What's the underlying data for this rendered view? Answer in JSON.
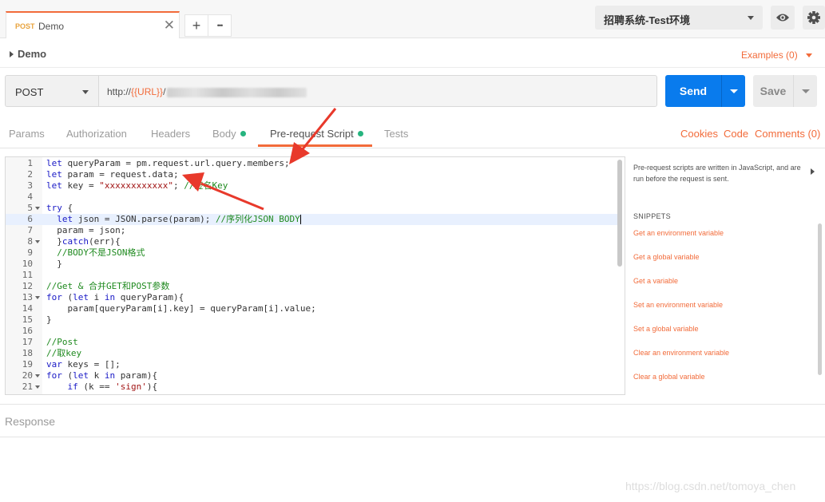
{
  "tab": {
    "method": "POST",
    "name": "Demo",
    "close": "✕",
    "new_tab": "+",
    "more": "•••"
  },
  "environment": {
    "selected": "招聘系统-Test环境"
  },
  "request": {
    "title": "Demo",
    "examples": "Examples (0)"
  },
  "url_bar": {
    "method": "POST",
    "url_prefix": "http://",
    "url_var": "{{URL}}",
    "url_suffix": "/"
  },
  "buttons": {
    "send": "Send",
    "save": "Save"
  },
  "subtabs": {
    "params": "Params",
    "authorization": "Authorization",
    "headers": "Headers",
    "body": "Body",
    "prerequest": "Pre-request Script",
    "tests": "Tests"
  },
  "links": {
    "cookies": "Cookies",
    "code": "Code",
    "comments": "Comments (0)"
  },
  "editor": {
    "cursor_line": 6,
    "lines": [
      {
        "n": "1",
        "fold": false,
        "parts": [
          [
            "kw",
            "let"
          ],
          [
            "t",
            " queryParam = pm.request.url.query.members;"
          ]
        ]
      },
      {
        "n": "2",
        "fold": false,
        "parts": [
          [
            "kw",
            "let"
          ],
          [
            "t",
            " param = request.data;"
          ]
        ]
      },
      {
        "n": "3",
        "fold": false,
        "parts": [
          [
            "kw",
            "let"
          ],
          [
            "t",
            " key = "
          ],
          [
            "str",
            "\"xxxxxxxxxxxx\""
          ],
          [
            "t",
            "; "
          ],
          [
            "cm",
            "//签名Key"
          ]
        ]
      },
      {
        "n": "4",
        "fold": false,
        "parts": []
      },
      {
        "n": "5",
        "fold": true,
        "parts": [
          [
            "kw",
            "try"
          ],
          [
            "t",
            " {"
          ]
        ]
      },
      {
        "n": "6",
        "fold": false,
        "parts": [
          [
            "t",
            "  "
          ],
          [
            "kw",
            "let"
          ],
          [
            "t",
            " json = JSON.parse(param); "
          ],
          [
            "cm",
            "//序列化JSON BODY"
          ]
        ]
      },
      {
        "n": "7",
        "fold": false,
        "parts": [
          [
            "t",
            "  param = json;"
          ]
        ]
      },
      {
        "n": "8",
        "fold": true,
        "parts": [
          [
            "t",
            "  }"
          ],
          [
            "kw",
            "catch"
          ],
          [
            "t",
            "(err){"
          ]
        ]
      },
      {
        "n": "9",
        "fold": false,
        "parts": [
          [
            "t",
            "  "
          ],
          [
            "cm",
            "//BODY不是JSON格式"
          ]
        ]
      },
      {
        "n": "10",
        "fold": false,
        "parts": [
          [
            "t",
            "  }"
          ]
        ]
      },
      {
        "n": "11",
        "fold": false,
        "parts": []
      },
      {
        "n": "12",
        "fold": false,
        "parts": [
          [
            "cm",
            "//Get & 合并GET和POST参数"
          ]
        ]
      },
      {
        "n": "13",
        "fold": true,
        "parts": [
          [
            "kw",
            "for"
          ],
          [
            "t",
            " ("
          ],
          [
            "kw",
            "let"
          ],
          [
            "t",
            " i "
          ],
          [
            "kw",
            "in"
          ],
          [
            "t",
            " queryParam){"
          ]
        ]
      },
      {
        "n": "14",
        "fold": false,
        "parts": [
          [
            "t",
            "    param[queryParam[i].key] = queryParam[i].value;"
          ]
        ]
      },
      {
        "n": "15",
        "fold": false,
        "parts": [
          [
            "t",
            "}"
          ]
        ]
      },
      {
        "n": "16",
        "fold": false,
        "parts": []
      },
      {
        "n": "17",
        "fold": false,
        "parts": [
          [
            "cm",
            "//Post"
          ]
        ]
      },
      {
        "n": "18",
        "fold": false,
        "parts": [
          [
            "cm",
            "//取key"
          ]
        ]
      },
      {
        "n": "19",
        "fold": false,
        "parts": [
          [
            "kw",
            "var"
          ],
          [
            "t",
            " keys = [];"
          ]
        ]
      },
      {
        "n": "20",
        "fold": true,
        "parts": [
          [
            "kw",
            "for"
          ],
          [
            "t",
            " ("
          ],
          [
            "kw",
            "let"
          ],
          [
            "t",
            " k "
          ],
          [
            "kw",
            "in"
          ],
          [
            "t",
            " param){"
          ]
        ]
      },
      {
        "n": "21",
        "fold": true,
        "parts": [
          [
            "t",
            "    "
          ],
          [
            "kw",
            "if"
          ],
          [
            "t",
            " (k == "
          ],
          [
            "str",
            "'sign'"
          ],
          [
            "t",
            "){"
          ]
        ]
      }
    ]
  },
  "side_panel": {
    "description": "Pre-request scripts are written in JavaScript, and are run before the request is sent.",
    "snippets_title": "SNIPPETS",
    "snippets": [
      "Get an environment variable",
      "Get a global variable",
      "Get a variable",
      "Set an environment variable",
      "Set a global variable",
      "Clear an environment variable",
      "Clear a global variable"
    ]
  },
  "response": {
    "label": "Response"
  },
  "watermark": "https://blog.csdn.net/tomoya_chen",
  "colors": {
    "accent": "#f26b3a",
    "send": "#097bed",
    "active_dot": "#26b47f",
    "arrow": "#e8392b"
  },
  "icons": [
    "eye-icon",
    "gear-icon",
    "close-icon",
    "plus-icon",
    "more-icon",
    "chevron-down-icon",
    "chevron-right-icon"
  ]
}
